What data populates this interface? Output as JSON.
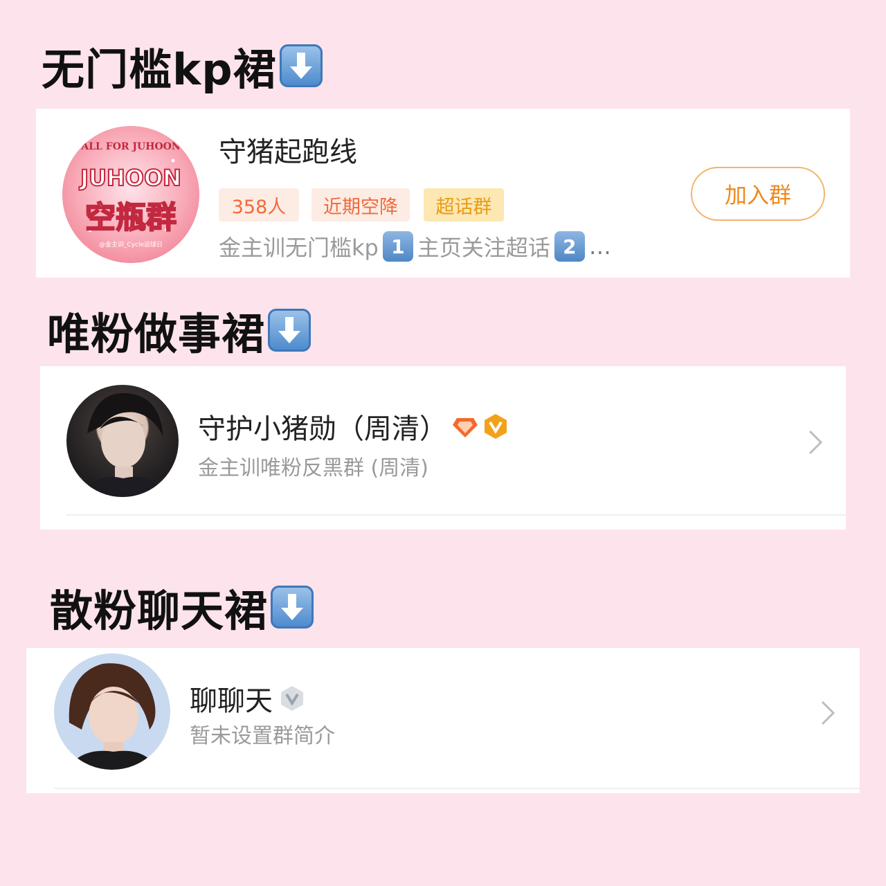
{
  "sections": [
    {
      "title": "无门槛kp裙"
    },
    {
      "title": "唯粉做事裙"
    },
    {
      "title": "散粉聊天裙"
    }
  ],
  "group1": {
    "name": "守猪起跑线",
    "tags": [
      "358人",
      "近期空降",
      "超话群"
    ],
    "tag_colors": {
      "bg1": "#fdece4",
      "fg1": "#f06a3c",
      "bg2": "#fdece4",
      "fg2": "#f06a3c",
      "bg3": "#fde7b2",
      "fg3": "#e89b16"
    },
    "desc_part1": "金主训无门槛kp",
    "desc_num1": "1",
    "desc_part2": "主页关注超话",
    "desc_num2": "2",
    "desc_ellipsis": "…",
    "join_label": "加入群",
    "avatar_top_text": "ALL FOR JUHOON",
    "avatar_main_text": "JUHOON",
    "avatar_sub_text": "空瓶群",
    "avatar_bottom_text": "@金主训_Cycle运球日"
  },
  "group2": {
    "name": "守护小猪勋（周清）",
    "desc": "金主训唯粉反黑群 (周清)"
  },
  "group3": {
    "name": "聊聊天",
    "desc": "暂未设置群简介"
  },
  "colors": {
    "background": "#fde3ec",
    "accent": "#ee8a1e"
  }
}
